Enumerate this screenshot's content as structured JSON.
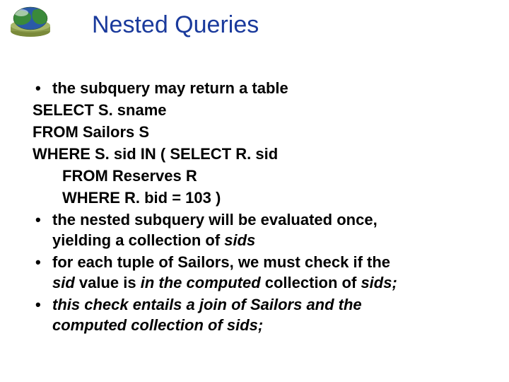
{
  "title": "Nested Queries",
  "bullets": {
    "b1": "the subquery may return a table",
    "sql1": "SELECT S. sname",
    "sql2": "FROM Sailors S",
    "sql3": "WHERE S. sid IN ( SELECT R. sid",
    "sql4": "FROM Reserves R",
    "sql5": "WHERE R. bid = 103 )",
    "b2a": "the nested subquery will be evaluated once,",
    "b2b_pre": "yielding a collection of ",
    "b2b_it": "sids",
    "b3a": "for each tuple of Sailors, we must check if the",
    "b3b_it1": "sid",
    "b3b_mid": " value is ",
    "b3b_it2": "in the computed",
    "b3b_mid2": " collection of ",
    "b3b_it3": "sids;",
    "b4a": "this check entails a join of Sailors and the",
    "b4b": "computed collection of sids;"
  }
}
